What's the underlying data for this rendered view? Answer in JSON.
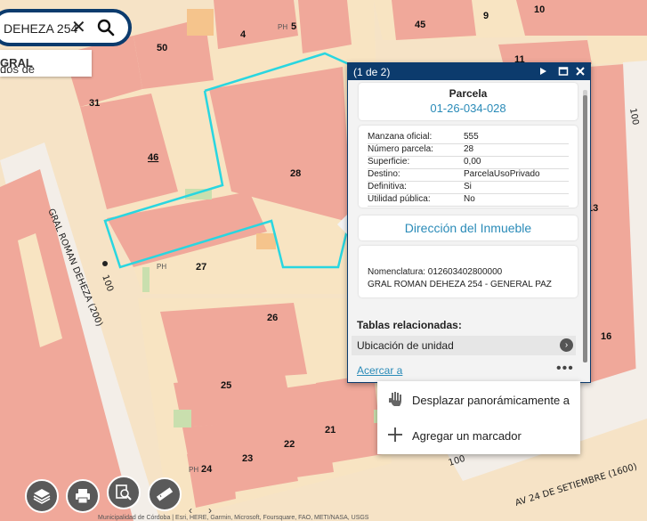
{
  "search": {
    "value": "DEHEZA 254",
    "clear_icon": "close-icon",
    "search_icon": "search-icon",
    "suggestion_prefix": "dos de ",
    "suggestion_bold": "GRAL",
    "suggestion_suffix": " ..."
  },
  "map": {
    "parcels": [
      "50",
      "4",
      "5",
      "45",
      "9",
      "10",
      "11",
      "31",
      "46",
      "28",
      "27",
      "26",
      "25",
      "23",
      "22",
      "21",
      "24",
      "13",
      "16"
    ],
    "ph_labels": [
      "PH",
      "PH",
      "PH",
      "PH"
    ],
    "streets": {
      "left": "GRAL ROMAN DEHEZA (200)",
      "left_number": "100",
      "bottom": "AV 24 DE SETIEMBRE (1600)",
      "bottom_number": "100",
      "right_number": "100"
    }
  },
  "popup": {
    "count": "(1 de 2)",
    "title": "Parcela",
    "parcel_id": "01-26-034-028",
    "attributes": [
      {
        "key": "Manzana oficial:",
        "value": "555"
      },
      {
        "key": "Número parcela:",
        "value": "28"
      },
      {
        "key": "Superficie:",
        "value": "0,00"
      },
      {
        "key": "Destino:",
        "value": "ParcelaUsoPrivado"
      },
      {
        "key": "Definitiva:",
        "value": "Si"
      },
      {
        "key": "Utilidad pública:",
        "value": "No"
      }
    ],
    "address_link": "Dirección del Inmueble",
    "nomenclatura": "Nomenclatura: 012603402800000",
    "address_line": "GRAL ROMAN DEHEZA 254 - GENERAL PAZ",
    "related_title": "Tablas relacionadas:",
    "related_item": "Ubicación de unidad",
    "zoom_link": "Acercar a",
    "more": "•••"
  },
  "context_menu": {
    "items": [
      {
        "label": "Desplazar panorámicamente a",
        "icon": "pan-hand-icon"
      },
      {
        "label": "Agregar un marcador",
        "icon": "plus-icon"
      }
    ]
  },
  "toolbar": {
    "buttons": [
      "layers-icon",
      "print-icon",
      "query-icon",
      "measure-icon"
    ]
  },
  "attribution": "Municipalidad de Córdoba | Esri, HERE, Garmin, Microsoft, Foursquare, FAO, METI/NASA, USGS",
  "colors": {
    "building": "#f0a89a",
    "block": "#f8e4c2",
    "parcel_highlight": "#29d6e0",
    "header": "#0c3b6d",
    "link": "#2a8bb8"
  }
}
